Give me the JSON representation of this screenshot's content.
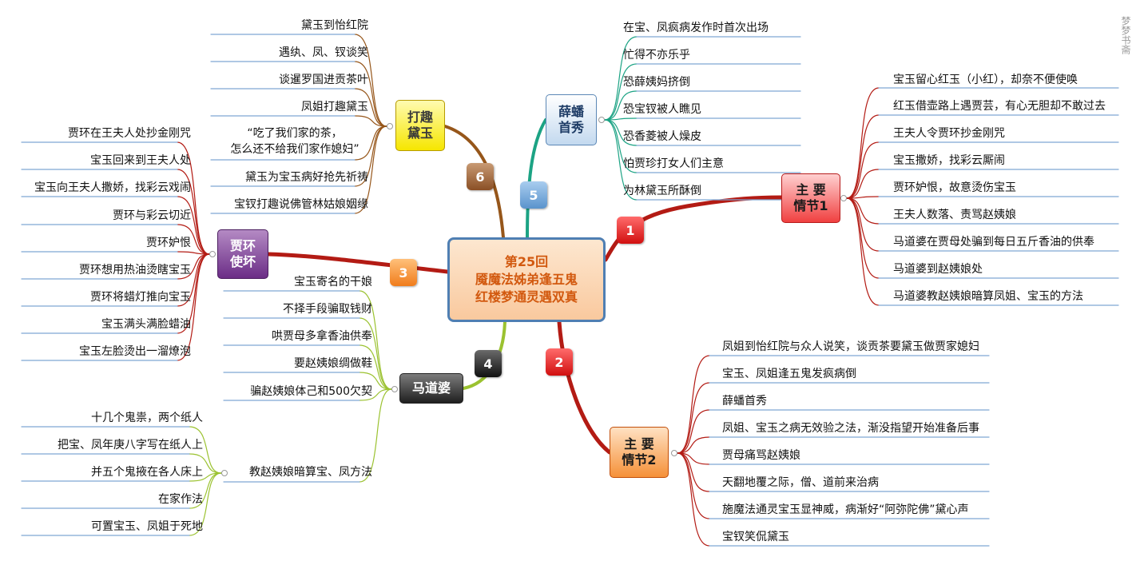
{
  "center": {
    "line1": "第25回",
    "line2": "魇魔法姊弟逢五鬼",
    "line3": "红楼梦通灵遇双真"
  },
  "numbers": [
    "1",
    "2",
    "3",
    "4",
    "5",
    "6"
  ],
  "colors": {
    "b1": "#b31b14",
    "b2": "#b31b14",
    "b3": "#b31b14",
    "b4": "#9bc230",
    "b5": "#1ca384",
    "b6": "#96561a"
  },
  "branches": {
    "b1": {
      "title1": "主 要",
      "title2": "情节1",
      "leaves": [
        "宝玉留心红玉（小红），却奈不便使唤",
        "红玉借壶路上遇贾芸，有心无胆却不敢过去",
        "王夫人令贾环抄金刚咒",
        "宝玉撒娇，找彩云厮闹",
        "贾环妒恨，故意烫伤宝玉",
        "王夫人数落、责骂赵姨娘",
        "马道婆在贾母处骗到每日五斤香油的供奉",
        "马道婆到赵姨娘处",
        "马道婆教赵姨娘暗算凤姐、宝玉的方法"
      ]
    },
    "b2": {
      "title1": "主 要",
      "title2": "情节2",
      "leaves": [
        "凤姐到怡红院与众人说笑，谈贡茶要黛玉做贾家媳妇",
        "宝玉、凤姐逢五鬼发疯病倒",
        "薛蟠首秀",
        "凤姐、宝玉之病无效验之法，渐没指望开始准备后事",
        "贾母痛骂赵姨娘",
        "天翻地覆之际，僧、道前来治病",
        "施魔法通灵宝玉显神威，病渐好“阿弥陀佛”黛心声",
        "宝钗笑侃黛玉"
      ]
    },
    "b3": {
      "title1": "贾环",
      "title2": "使坏",
      "leaves": [
        "贾环在王夫人处抄金刚咒",
        "宝玉回来到王夫人处",
        "宝玉向王夫人撒娇，找彩云戏闹",
        "贾环与彩云切近",
        "贾环妒恨",
        "贾环想用热油烫瞎宝玉",
        "贾环将蜡灯推向宝玉",
        "宝玉满头满脸蜡油",
        "宝玉左脸烫出一溜燎泡"
      ]
    },
    "b4": {
      "title1": "马道婆",
      "leaves": [
        "宝玉寄名的干娘",
        "不择手段骗取钱财",
        "哄贾母多拿香油供奉",
        "要赵姨娘绸做鞋",
        "骗赵姨娘体己和500欠契",
        "教赵姨娘暗算宝、凤方法"
      ],
      "sub": [
        "十几个鬼祟，两个纸人",
        "把宝、凤年庚八字写在纸人上",
        "并五个鬼掖在各人床上",
        "在家作法",
        "可置宝玉、凤姐于死地"
      ]
    },
    "b5": {
      "title1": "薛蟠",
      "title2": "首秀",
      "leaves": [
        "在宝、凤疯病发作时首次出场",
        "忙得不亦乐乎",
        "恐薛姨妈挤倒",
        "恐宝钗被人瞧见",
        "恐香菱被人燥皮",
        "怕贾珍打女人们主意",
        "为林黛玉所酥倒"
      ]
    },
    "b6": {
      "title1": "打趣",
      "title2": "黛玉",
      "leaves": [
        "黛玉到怡红院",
        "遇纨、凤、钗谈笑",
        "谈暹罗国进贡茶叶",
        "凤姐打趣黛玉",
        "“吃了我们家的茶，",
        "怎么还不给我们家作媳妇”",
        "黛玉为宝玉病好抢先祈祷",
        "宝钗打趣说佛管林姑娘姻缘"
      ]
    }
  },
  "watermark": "梦梦书斋"
}
